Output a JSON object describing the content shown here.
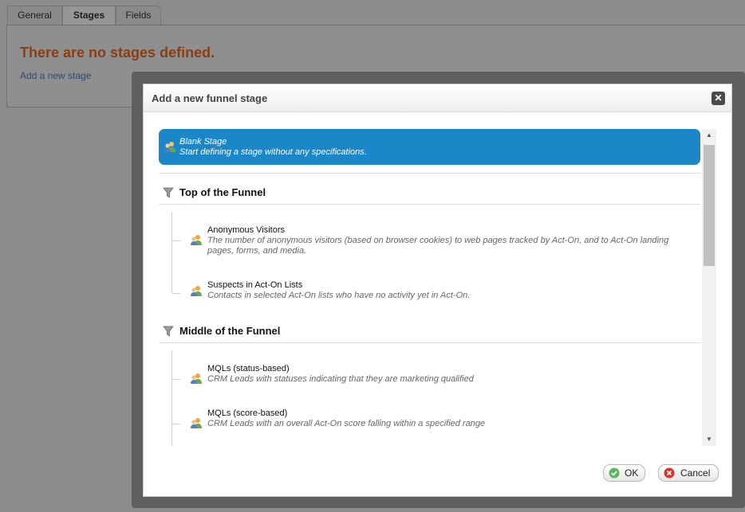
{
  "tabs": [
    {
      "label": "General"
    },
    {
      "label": "Stages"
    },
    {
      "label": "Fields"
    }
  ],
  "page": {
    "empty_message": "There are no stages defined.",
    "add_link": "Add a new stage"
  },
  "dialog": {
    "title": "Add a new funnel stage",
    "blank_stage": {
      "title": "Blank Stage",
      "description": "Start defining a stage without any specifications."
    },
    "sections": [
      {
        "title": "Top of the Funnel",
        "items": [
          {
            "title": "Anonymous Visitors",
            "description": "The number of anonymous visitors (based on browser cookies) to web pages tracked by Act-On, and to Act-On landing pages, forms, and media."
          },
          {
            "title": "Suspects in Act-On Lists",
            "description": "Contacts in selected Act-On lists who have no activity yet in Act-On."
          }
        ]
      },
      {
        "title": "Middle of the Funnel",
        "items": [
          {
            "title": "MQLs (status-based)",
            "description": "CRM Leads with statuses indicating that they are marketing qualified"
          },
          {
            "title": "MQLs (score-based)",
            "description": "CRM Leads with an overall Act-On score falling within a specified range"
          }
        ]
      }
    ],
    "ok_label": "OK",
    "cancel_label": "Cancel",
    "icons": {
      "close": "close-icon",
      "funnel": "funnel-icon",
      "people": "people-icon",
      "ok": "check-icon",
      "cancel": "cancel-icon"
    },
    "colors": {
      "selected": "#1b87c9",
      "empty_message": "#8a3d12"
    }
  }
}
